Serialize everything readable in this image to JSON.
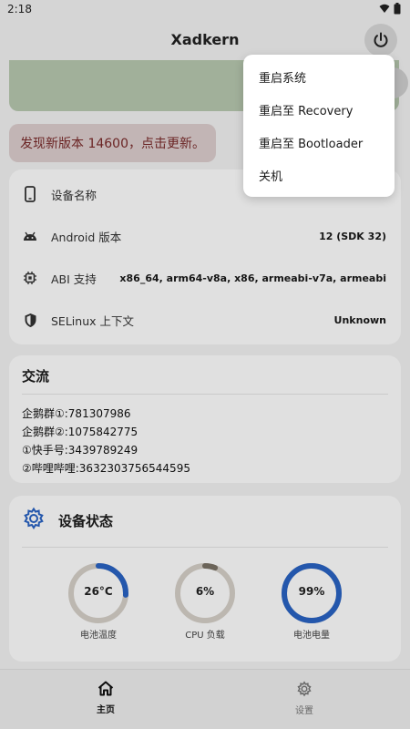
{
  "statusbar": {
    "time": "2:18"
  },
  "appbar": {
    "title": "Xadkern"
  },
  "update": {
    "message": "发现新版本 14600，点击更新。"
  },
  "device_info": [
    {
      "icon": "phone-icon",
      "label": "设备名称",
      "value": ""
    },
    {
      "icon": "android-icon",
      "label": "Android 版本",
      "value": "12 (SDK 32)"
    },
    {
      "icon": "chip-icon",
      "label": "ABI 支持",
      "value": "x86_64, arm64-v8a, x86, armeabi-v7a, armeabi"
    },
    {
      "icon": "shield-icon",
      "label": "SELinux 上下文",
      "value": "Unknown"
    }
  ],
  "community": {
    "title": "交流",
    "lines": [
      "企鹅群①:781307986",
      "企鹅群②:1075842775",
      "①快手号:3439789249",
      "②哔哩哔哩:3632303756544595"
    ]
  },
  "device_status": {
    "title": "设备状态",
    "gauges": [
      {
        "value": "26°C",
        "label": "电池温度",
        "fraction": 0.26,
        "color": "#2a63c4"
      },
      {
        "value": "6%",
        "label": "CPU 负载",
        "fraction": 0.06,
        "color": "#7a7266"
      },
      {
        "value": "99%",
        "label": "电池电量",
        "fraction": 0.99,
        "color": "#2a63c4"
      }
    ]
  },
  "bottom_nav": {
    "home": "主页",
    "settings": "设置"
  },
  "power_menu": {
    "items": [
      "重启系统",
      "重启至 Recovery",
      "重启至 Bootloader",
      "关机"
    ]
  }
}
